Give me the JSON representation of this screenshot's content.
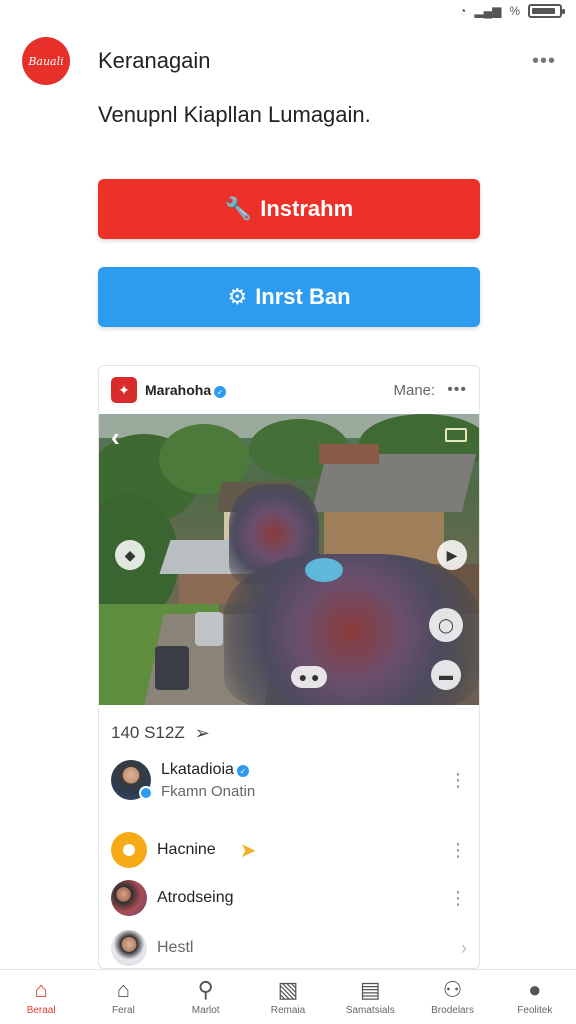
{
  "status_bar": {
    "battery_level": 0.9,
    "signal_text": "%"
  },
  "header": {
    "logo_text": "Bauali",
    "title": "Keranagain",
    "more": "•••"
  },
  "subtitle": "Venupnl Kiapllan Lumagain.",
  "buttons": {
    "primary": {
      "label": "Instrahm",
      "color": "#ee3128"
    },
    "secondary": {
      "label": "Inrst Ban",
      "color": "#2d9bf0"
    }
  },
  "post": {
    "author": "Marahoha",
    "action": "Mane:",
    "more": "•••",
    "stats": "140 S12Z",
    "list": [
      {
        "name": "Lkatadioia",
        "sub": "Fkamn Onatin",
        "verified": true
      },
      {
        "name": "Hacnine"
      },
      {
        "name": "Atrodseing"
      },
      {
        "name": "Hestl"
      }
    ]
  },
  "nav": {
    "items": [
      {
        "label": "Beraal",
        "icon": "home-icon",
        "active": true
      },
      {
        "label": "Feral",
        "icon": "home-outline-icon"
      },
      {
        "label": "Marlot",
        "icon": "search-icon"
      },
      {
        "label": "Remaia",
        "icon": "image-edit-icon"
      },
      {
        "label": "Samatsials",
        "icon": "message-icon"
      },
      {
        "label": "Brodelars",
        "icon": "people-icon"
      },
      {
        "label": "Feolitek",
        "icon": "profile-icon"
      }
    ]
  },
  "colors": {
    "accent_red": "#ee3128",
    "accent_blue": "#2d9bf0",
    "nav_active": "#e23a2f"
  }
}
